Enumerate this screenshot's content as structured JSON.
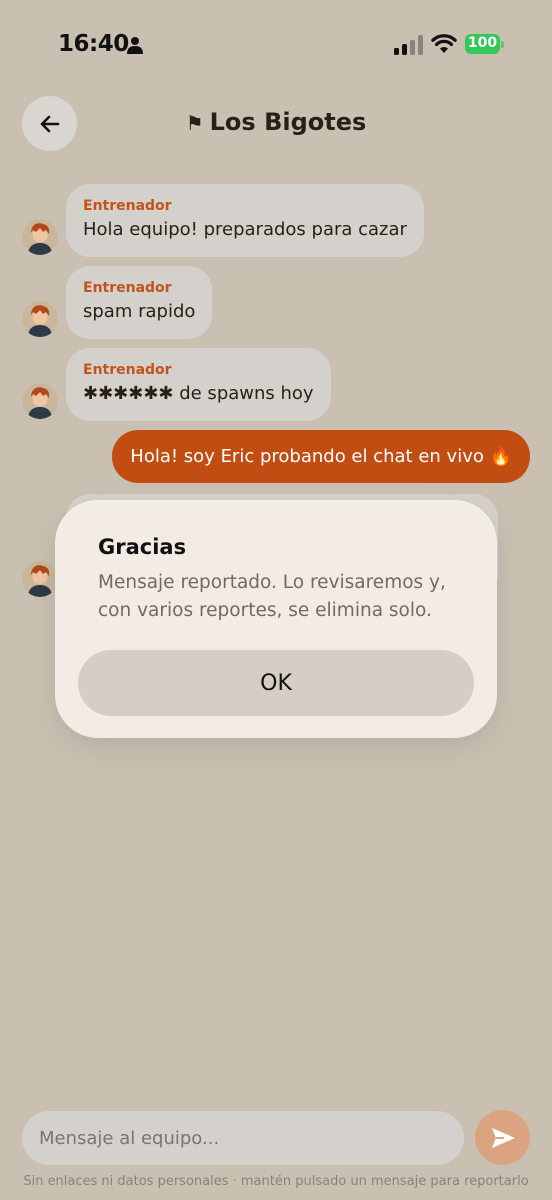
{
  "status_bar": {
    "time": "16:40",
    "battery": "100",
    "icons": [
      "person-icon",
      "signal-icon",
      "wifi-icon",
      "battery-icon"
    ],
    "battery_color": "#34c759"
  },
  "header": {
    "flag": "⚑",
    "title": "Los Bigotes",
    "back_icon": "arrow-left-icon"
  },
  "messages": [
    {
      "sender": "Entrenador",
      "text": "Hola equipo! preparados para cazar"
    },
    {
      "sender": "Entrenador",
      "text": "spam rapido"
    },
    {
      "sender": "Entrenador",
      "text": "✱✱✱✱✱✱ de spawns hoy"
    }
  ],
  "my_message": {
    "text": "Hola! soy Eric probando el chat en vivo 🔥"
  },
  "alert": {
    "title": "Gracias",
    "message": "Mensaje reportado. Lo revisaremos y, con varios reportes, se elimina solo.",
    "ok_label": "OK"
  },
  "composer": {
    "placeholder": "Mensaje al equipo...",
    "send_icon": "send-icon"
  },
  "footer": {
    "note": "Sin enlaces ni datos personales · mantén pulsado un mensaje para reportarlo"
  },
  "colors": {
    "background": "#cac0b2",
    "accent": "#c14d12",
    "sender_name": "#c3531a",
    "incoming_bubble": "#d4d0cb"
  }
}
